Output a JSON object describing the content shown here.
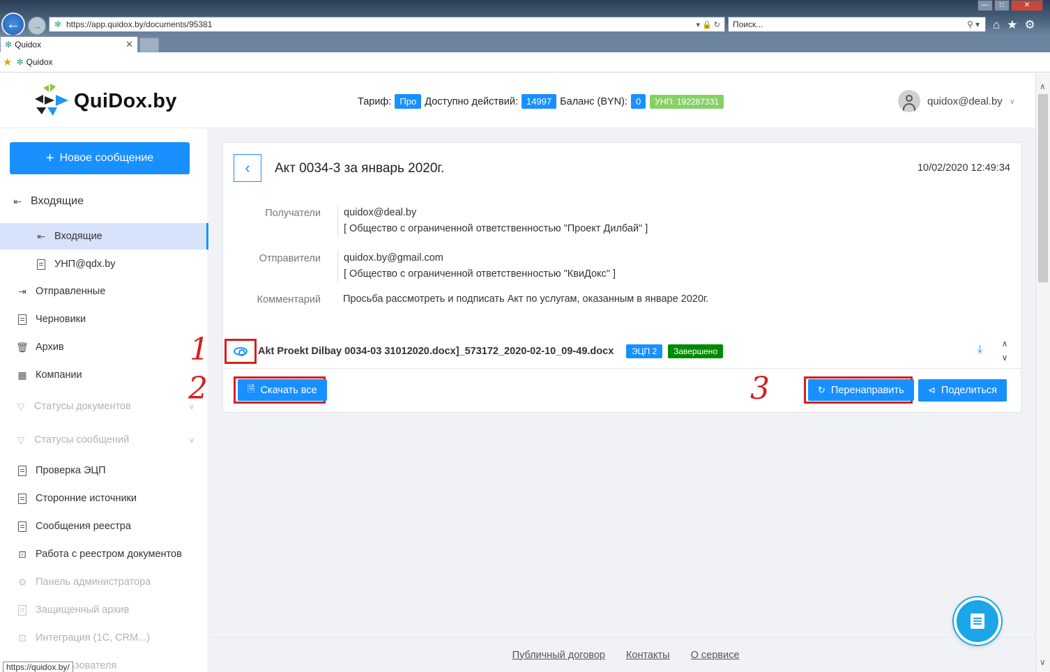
{
  "browser": {
    "url": "https://app.quidox.by/documents/95381",
    "search_placeholder": "Поиск...",
    "tab_title": "Quidox",
    "favorite_label": "Quidox",
    "status_url": "https://quidox.by/"
  },
  "header": {
    "logo_text": "QuiDox.by",
    "tariff_label": "Тариф:",
    "tariff_value": "Про",
    "actions_label": "Доступно действий:",
    "actions_value": "14997",
    "balance_label": "Баланс (BYN):",
    "balance_value": "0",
    "unp": "УНП: 192287331",
    "user_email": "quidox@deal.by"
  },
  "sidebar": {
    "new_message": "Новое сообщение",
    "items": [
      {
        "label": "Входящие",
        "icon": "inbox-icon"
      },
      {
        "label": "Входящие",
        "icon": "inbox-icon"
      },
      {
        "label": "УНП@qdx.by",
        "icon": "doc-badge-icon"
      },
      {
        "label": "Отправленные",
        "icon": "outbox-icon"
      },
      {
        "label": "Черновики",
        "icon": "file-icon"
      },
      {
        "label": "Архив",
        "icon": "trash-icon"
      },
      {
        "label": "Компании",
        "icon": "org-icon"
      },
      {
        "label": "Статусы документов",
        "icon": "filter-icon"
      },
      {
        "label": "Статусы сообщений",
        "icon": "filter-icon"
      },
      {
        "label": "Проверка ЭЦП",
        "icon": "doc-check-icon"
      },
      {
        "label": "Сторонние источники",
        "icon": "file-icon"
      },
      {
        "label": "Сообщения реестра",
        "icon": "file-icon"
      },
      {
        "label": "Работа с реестром документов",
        "icon": "terminal-icon"
      },
      {
        "label": "Панель администратора",
        "icon": "gear-icon"
      },
      {
        "label": "Защищенный архив",
        "icon": "file-icon"
      },
      {
        "label": "Интеграция (1С, CRM...)",
        "icon": "terminal-icon"
      },
      {
        "label": "льзователя",
        "icon": "user-icon"
      }
    ]
  },
  "document": {
    "title": "Акт 0034-3 за январь 2020г.",
    "date": "10/02/2020 12:49:34",
    "recipients_label": "Получатели",
    "recipient_email": "quidox@deal.by",
    "recipient_org": "[ Общество с ограниченной ответственностью \"Проект Дилбай\" ]",
    "senders_label": "Отправители",
    "sender_email": "quidox.by@gmail.com",
    "sender_org": "[ Общество с ограниченной ответственностью \"КвиДокс\" ]",
    "comment_label": "Комментарий",
    "comment": "Просьба рассмотреть и подписать Акт по услугам, оказанным в январе 2020г.",
    "file_name": "Akt Proekt Dilbay 0034-03 31012020.docx]_573172_2020-02-10_09-49.docx",
    "tag_ecp": "ЭЦП 2",
    "tag_status": "Завершено",
    "download_all": "Скачать все",
    "forward": "Перенаправить",
    "share": "Поделиться"
  },
  "annotations": [
    "1",
    "2",
    "3"
  ],
  "footer": {
    "links": [
      "Публичный договор",
      "Контакты",
      "О сервисе"
    ]
  },
  "colors": {
    "primary": "#1890ff",
    "annotation_red": "#d81e1e",
    "unp_green": "#87d068",
    "status_green": "#008a00",
    "selected_bg": "#d7e3fb"
  }
}
